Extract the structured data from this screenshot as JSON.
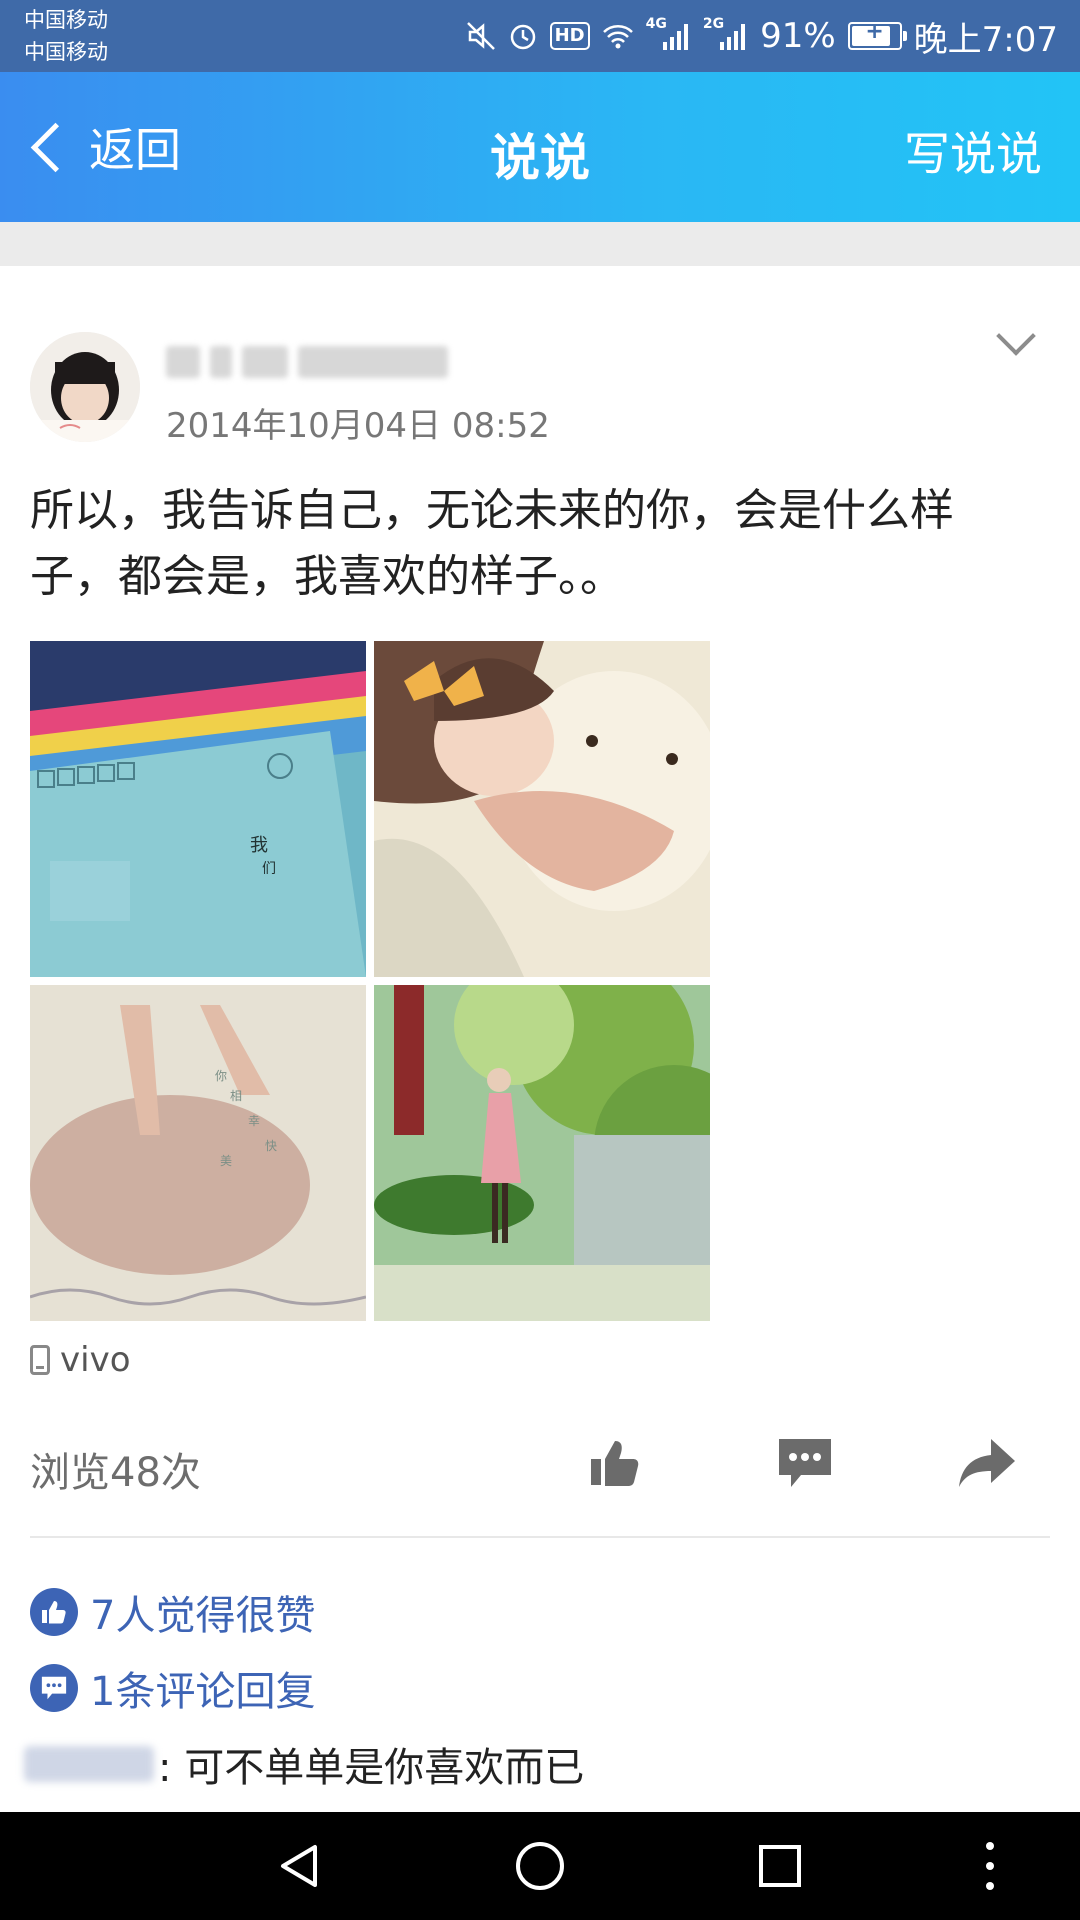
{
  "status_bar": {
    "carrier_1": "中国移动",
    "carrier_2": "中国移动",
    "hd": "HD",
    "net_4g": "4G",
    "net_2g": "2G",
    "battery_percent": "91%",
    "battery_level": 0.91,
    "time": "晚上7:07",
    "icons": [
      "mute-icon",
      "alarm-icon",
      "hd-icon",
      "wifi-icon",
      "signal-4g-icon",
      "signal-2g-icon",
      "battery-charging-icon"
    ]
  },
  "header": {
    "back_label": "返回",
    "title": "说说",
    "write_label": "写说说",
    "gradient_colors": [
      "#3a8df0",
      "#22c4f6"
    ]
  },
  "post": {
    "timestamp": "2014年10月04日 08:52",
    "text": "所以，我告诉自己，无论未来的你，会是什么样子，都会是，我喜欢的样子。。",
    "photo_count": 4,
    "device": "vivo",
    "views": "浏览48次"
  },
  "actions": [
    "like-icon",
    "comment-icon",
    "share-icon"
  ],
  "summary": {
    "likes": "7人觉得很赞",
    "comments": "1条评论回复",
    "accent_color": "#3d64b5"
  },
  "comments": [
    {
      "text": ": 可不单单是你喜欢而已"
    }
  ],
  "nav": [
    "back-triangle-icon",
    "home-circle-icon",
    "recent-square-icon",
    "more-dots-icon"
  ]
}
